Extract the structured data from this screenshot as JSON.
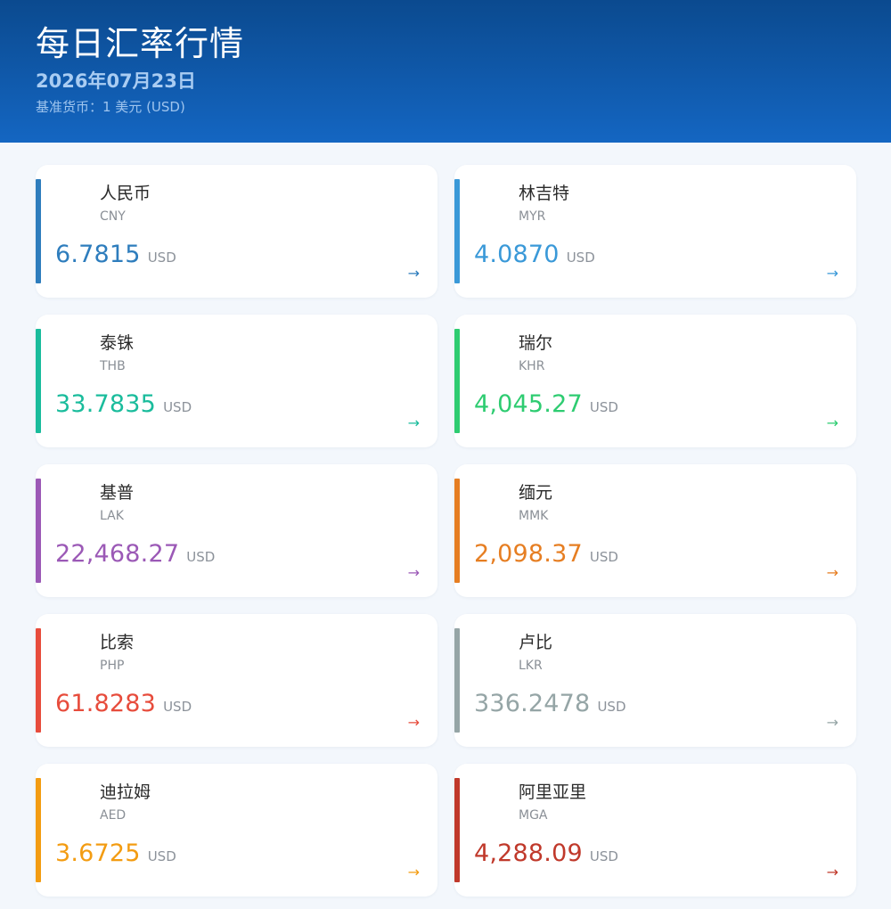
{
  "header": {
    "title": "每日汇率行情",
    "date": "2026年07月23日",
    "base_currency": "基准货币：1 美元 (USD)"
  },
  "arrow_glyph": "→",
  "cards": [
    {
      "name": "人民币",
      "code": "CNY",
      "rate": "6.7815",
      "unit": "USD",
      "color": "#2e7dbd",
      "icon": "arrow-right-icon"
    },
    {
      "name": "林吉特",
      "code": "MYR",
      "rate": "4.0870",
      "unit": "USD",
      "color": "#3a99d8",
      "icon": "arrow-right-icon"
    },
    {
      "name": "泰铢",
      "code": "THB",
      "rate": "33.7835",
      "unit": "USD",
      "color": "#1abc9c",
      "icon": "arrow-right-icon"
    },
    {
      "name": "瑞尔",
      "code": "KHR",
      "rate": "4,045.27",
      "unit": "USD",
      "color": "#2ecc71",
      "icon": "arrow-right-icon"
    },
    {
      "name": "基普",
      "code": "LAK",
      "rate": "22,468.27",
      "unit": "USD",
      "color": "#9b59b6",
      "icon": "arrow-right-icon"
    },
    {
      "name": "缅元",
      "code": "MMK",
      "rate": "2,098.37",
      "unit": "USD",
      "color": "#e67e22",
      "icon": "arrow-right-icon"
    },
    {
      "name": "比索",
      "code": "PHP",
      "rate": "61.8283",
      "unit": "USD",
      "color": "#e74c3c",
      "icon": "arrow-right-icon"
    },
    {
      "name": "卢比",
      "code": "LKR",
      "rate": "336.2478",
      "unit": "USD",
      "color": "#95a5a6",
      "icon": "arrow-right-icon"
    },
    {
      "name": "迪拉姆",
      "code": "AED",
      "rate": "3.6725",
      "unit": "USD",
      "color": "#f39c12",
      "icon": "arrow-right-icon"
    },
    {
      "name": "阿里亚里",
      "code": "MGA",
      "rate": "4,288.09",
      "unit": "USD",
      "color": "#c0392b",
      "icon": "arrow-right-icon"
    }
  ]
}
